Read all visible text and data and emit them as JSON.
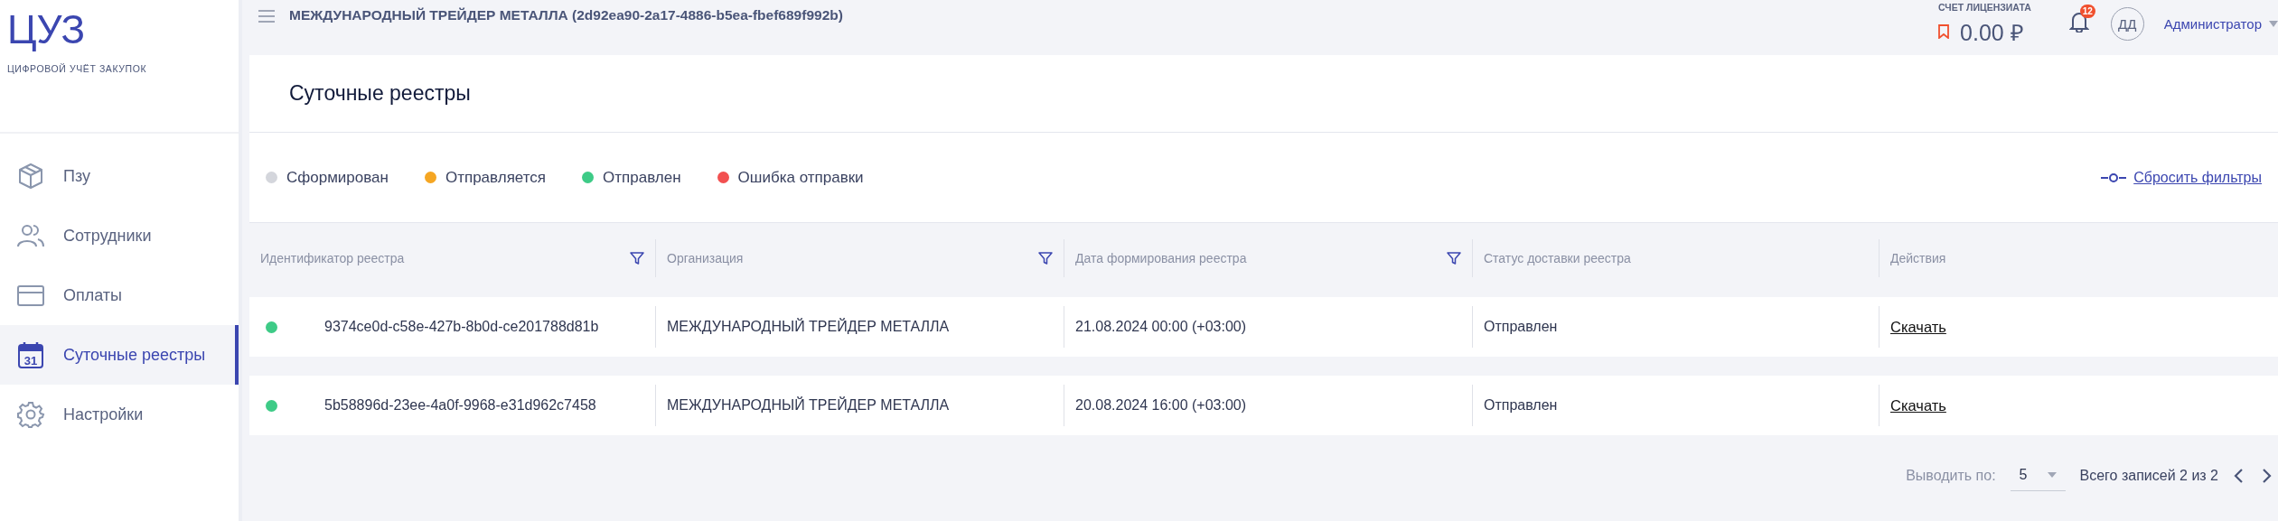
{
  "logo": {
    "title": "ЦУЗ",
    "subtitle": "ЦИФРОВОЙ УЧЁТ ЗАКУПОК"
  },
  "sidebar": {
    "items": [
      {
        "label": "Пзу",
        "kind": "box",
        "selected": false
      },
      {
        "label": "Сотрудники",
        "kind": "people",
        "selected": false
      },
      {
        "label": "Оплаты",
        "kind": "card",
        "selected": false
      },
      {
        "label": "Суточные реестры",
        "kind": "calendar",
        "icon_text": "31",
        "selected": true
      },
      {
        "label": "Настройки",
        "kind": "gear",
        "selected": false
      }
    ]
  },
  "header": {
    "title": "МЕЖДУНАРОДНЫЙ ТРЕЙДЕР МЕТАЛЛА (2d92ea90-2a17-4886-b5ea-fbef689f992b)",
    "license": {
      "label": "СЧЕТ ЛИЦЕНЗИАТА",
      "amount": "0.00 ₽"
    },
    "notifications": "12",
    "avatar": "ДД",
    "user": "Администратор"
  },
  "page": {
    "title": "Суточные реестры"
  },
  "legend": [
    {
      "label": "Сформирован",
      "color": "#d4d6dc"
    },
    {
      "label": "Отправляется",
      "color": "#f5a623"
    },
    {
      "label": "Отправлен",
      "color": "#3ecb87"
    },
    {
      "label": "Ошибка отправки",
      "color": "#f25050"
    }
  ],
  "reset_filters": "Сбросить фильтры",
  "table": {
    "columns": [
      {
        "label": "Идентификатор реестра",
        "filter": true
      },
      {
        "label": "Организация",
        "filter": true
      },
      {
        "label": "Дата формирования реестра",
        "filter": true
      },
      {
        "label": "Статус доставки реестра",
        "filter": false
      },
      {
        "label": "Действия",
        "filter": false
      }
    ],
    "rows": [
      {
        "color": "#3ecb87",
        "id": "9374ce0d-c58e-427b-8b0d-ce201788d81b",
        "organization": "МЕЖДУНАРОДНЫЙ ТРЕЙДЕР МЕТАЛЛА",
        "date": "21.08.2024 00:00 (+03:00)",
        "status": "Отправлен",
        "action": "Скачать"
      },
      {
        "color": "#3ecb87",
        "id": "5b58896d-23ee-4a0f-9968-e31d962c7458",
        "organization": "МЕЖДУНАРОДНЫЙ ТРЕЙДЕР МЕТАЛЛА",
        "date": "20.08.2024 16:00 (+03:00)",
        "status": "Отправлен",
        "action": "Скачать"
      }
    ]
  },
  "pagination": {
    "label": "Выводить по:",
    "page_size": "5",
    "total": "Всего записей 2 из 2"
  }
}
